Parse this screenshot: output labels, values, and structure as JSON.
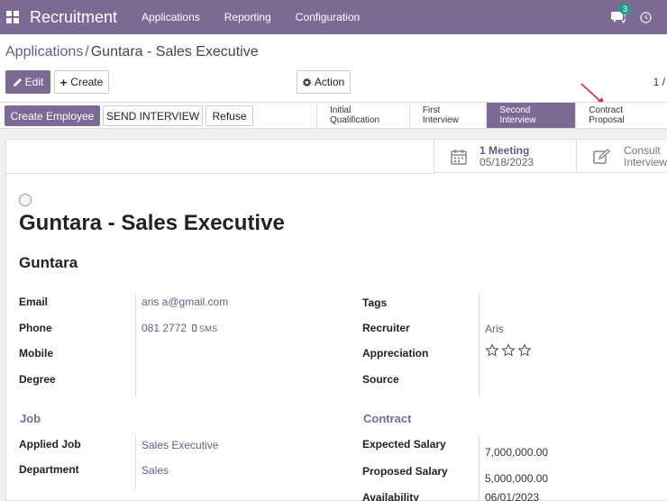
{
  "navbar": {
    "app_title": "Recruitment",
    "menu": [
      "Applications",
      "Reporting",
      "Configuration"
    ],
    "chat_count": "3"
  },
  "breadcrumb": {
    "parent": "Applications",
    "separator": "/",
    "current": "Guntara - Sales Executive"
  },
  "controls": {
    "edit": "Edit",
    "create": "Create",
    "action": "Action",
    "pager": "1 /"
  },
  "statusbar": {
    "create_employee": "Create Employee",
    "send_interview": "SEND INTERVIEW",
    "refuse": "Refuse",
    "stages": [
      {
        "label": "Initial Qualification",
        "active": false
      },
      {
        "label": "First Interview",
        "active": false
      },
      {
        "label": "Second Interview",
        "active": true
      },
      {
        "label": "Contract Proposal",
        "active": false
      }
    ]
  },
  "smart_buttons": {
    "meeting_count": "1 Meeting",
    "meeting_date": "05/18/2023",
    "consult_line1": "Consult",
    "consult_line2": "Interview"
  },
  "record": {
    "title": "Guntara - Sales Executive",
    "partner_name": "Guntara",
    "labels": {
      "email": "Email",
      "phone": "Phone",
      "mobile": "Mobile",
      "degree": "Degree",
      "tags": "Tags",
      "recruiter": "Recruiter",
      "appreciation": "Appreciation",
      "source": "Source",
      "applied_job": "Applied Job",
      "department": "Department",
      "expected_salary": "Expected Salary",
      "proposed_salary": "Proposed Salary",
      "availability": "Availability"
    },
    "values": {
      "email": "aris          a@gmail.com",
      "phone": "081          2772",
      "sms": "SMS",
      "recruiter": "Aris",
      "appreciation_stars": 0,
      "applied_job": "Sales Executive",
      "department": "Sales",
      "expected_salary": "7,000,000.00",
      "proposed_salary": "5,000,000.00",
      "availability": "06/01/2023"
    },
    "sections": {
      "job": "Job",
      "contract": "Contract"
    }
  },
  "colors": {
    "brand": "#7c6a95",
    "link": "#6a5a84",
    "badge": "#1aa38a",
    "annotation_arrow": "#e0245e"
  }
}
